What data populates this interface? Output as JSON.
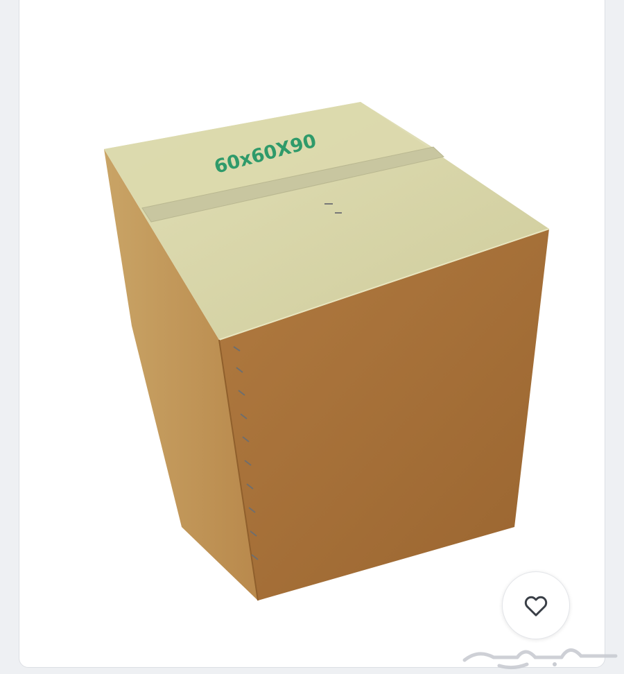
{
  "listing": {
    "box_size_label": "60x60X90",
    "favorite_action": "heart-icon",
    "watermark_brand": "حراج"
  },
  "colors": {
    "page_background": "#eef0f3",
    "card_background": "#ffffff",
    "box_top": "#d6d4a8",
    "box_front": "#a8743e",
    "box_side": "#c29a5c",
    "label_green": "#2f9a6a",
    "heart_stroke": "#3a3f47"
  }
}
